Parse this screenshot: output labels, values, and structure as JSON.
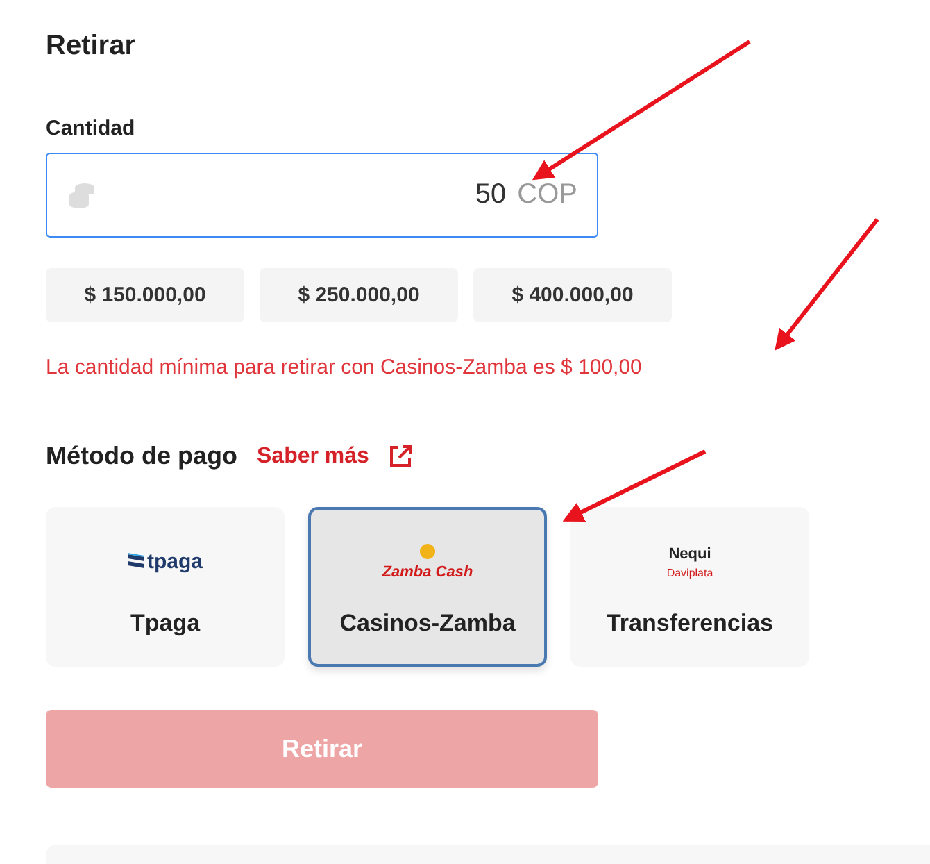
{
  "title": "Retirar",
  "amount": {
    "label": "Cantidad",
    "value": "50",
    "currency": "COP",
    "focused": true
  },
  "presets": [
    "$ 150.000,00",
    "$ 250.000,00",
    "$ 400.000,00"
  ],
  "error": "La cantidad mínima para retirar con Casinos-Zamba es $ 100,00",
  "payment": {
    "label": "Método de pago",
    "link": "Saber más",
    "methods": [
      {
        "kind": "tpaga",
        "name": "Tpaga",
        "logo_text": [
          "tpaga"
        ],
        "selected": false
      },
      {
        "kind": "zamba",
        "name": "Casinos-Zamba",
        "logo_text": [
          "Zamba Cash"
        ],
        "selected": true
      },
      {
        "kind": "nequi",
        "name": "Transferencias",
        "logo_text": [
          "Nequi",
          "Daviplata"
        ],
        "selected": false
      }
    ]
  },
  "submit": {
    "label": "Retirar",
    "disabled": true
  },
  "annotation_arrows": [
    {
      "kind": "amount"
    },
    {
      "kind": "error"
    },
    {
      "kind": "method"
    }
  ]
}
